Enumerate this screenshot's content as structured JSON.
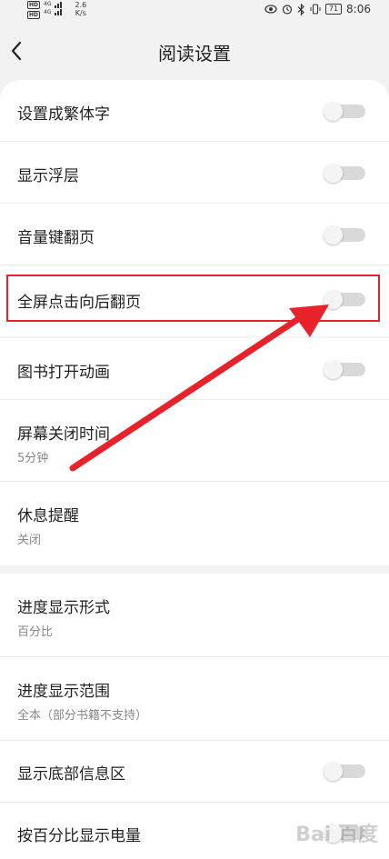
{
  "status_bar": {
    "hd1": "HD",
    "hd2": "HD",
    "net1": "4G",
    "net2": "4G",
    "speed_value": "2.6",
    "speed_unit": "K/s",
    "battery": "71",
    "time": "8:06"
  },
  "header": {
    "title": "阅读设置"
  },
  "settings": {
    "traditional": {
      "label": "设置成繁体字",
      "enabled": false
    },
    "floating_layer": {
      "label": "显示浮层",
      "enabled": false
    },
    "volume_page": {
      "label": "音量键翻页",
      "enabled": false
    },
    "fullscreen_tap": {
      "label": "全屏点击向后翻页",
      "enabled": false
    },
    "book_open_anim": {
      "label": "图书打开动画",
      "enabled": false
    },
    "screen_off": {
      "label": "屏幕关闭时间",
      "value": "5分钟"
    },
    "rest_reminder": {
      "label": "休息提醒",
      "value": "关闭"
    },
    "progress_format": {
      "label": "进度显示形式",
      "value": "百分比"
    },
    "progress_range": {
      "label": "进度显示范围",
      "value": "全本（部分书籍不支持）"
    },
    "bottom_info": {
      "label": "显示底部信息区",
      "enabled": false
    },
    "battery_percent": {
      "label": "按百分比显示电量",
      "enabled": false
    }
  },
  "colors": {
    "highlight": "#e8222b",
    "toggle_off_track": "#d9d9d9"
  },
  "icons": {
    "back": "chevron-left-icon",
    "eye": "eye-icon",
    "alarm": "alarm-icon",
    "bluetooth": "bluetooth-icon",
    "vibrate": "vibrate-icon"
  },
  "watermark": "Bai 百度"
}
